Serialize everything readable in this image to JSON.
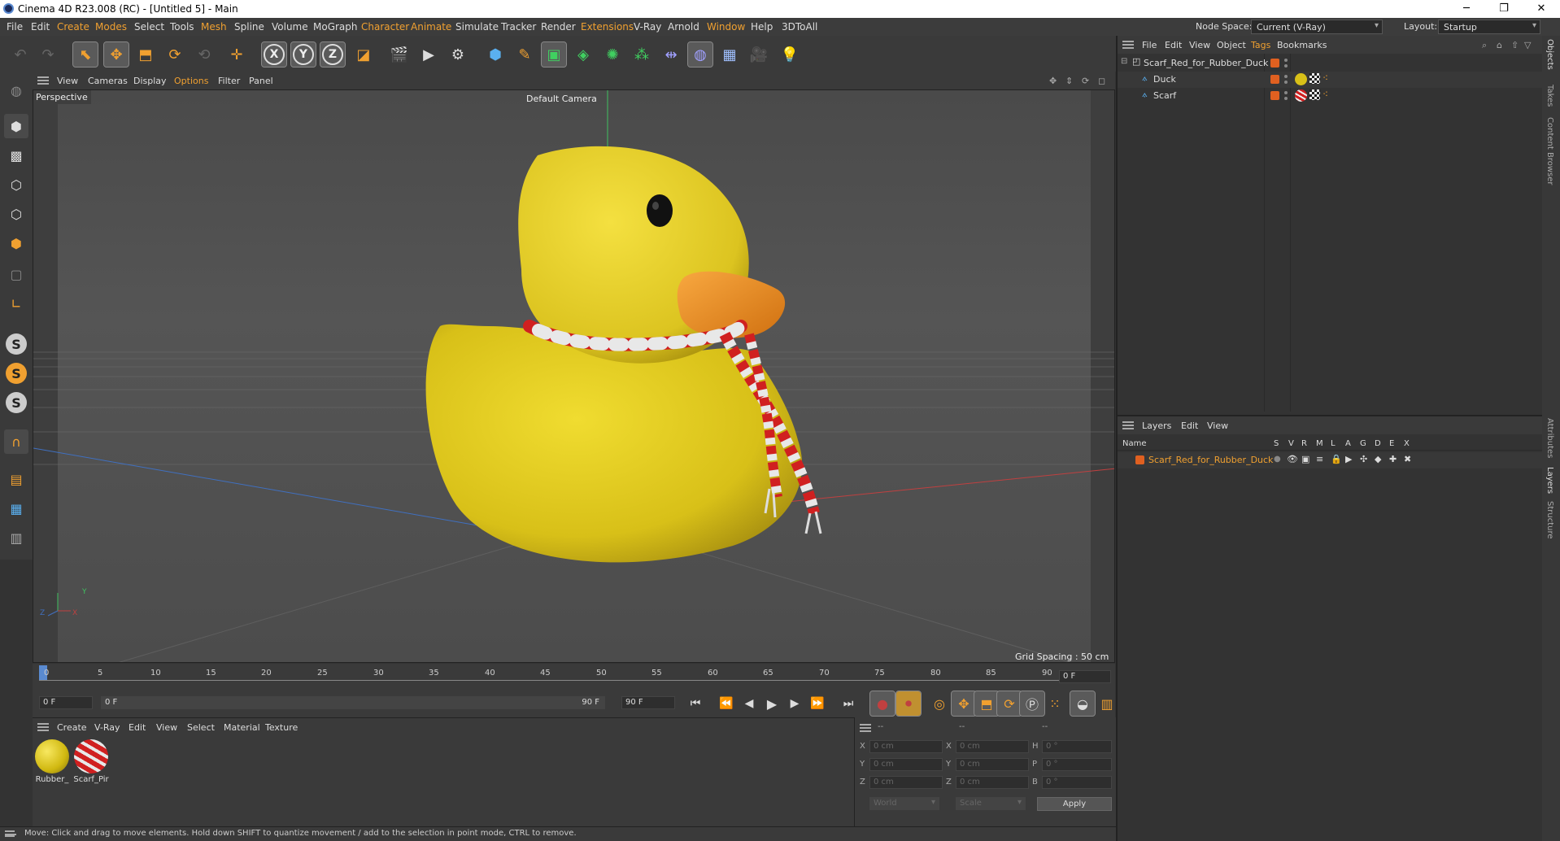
{
  "window": {
    "title": "Cinema 4D R23.008 (RC) - [Untitled 5] - Main",
    "minimize": "─",
    "restore": "❐",
    "close": "✕"
  },
  "menubar": {
    "items": [
      "File",
      "Edit",
      "Create",
      "Modes",
      "Select",
      "Tools",
      "Mesh",
      "Spline",
      "Volume",
      "MoGraph",
      "Character",
      "Animate",
      "Simulate",
      "Tracker",
      "Render",
      "Extensions",
      "V-Ray",
      "Arnold",
      "Window",
      "Help",
      "3DToAll"
    ],
    "node_space_label": "Node Space:",
    "node_space_value": "Current (V-Ray)",
    "layout_label": "Layout:",
    "layout_value": "Startup"
  },
  "viewport_menu": {
    "items": [
      "View",
      "Cameras",
      "Display",
      "Options",
      "Filter",
      "Panel"
    ]
  },
  "viewport": {
    "label": "Perspective",
    "camera": "Default Camera",
    "grid_spacing": "Grid Spacing : 50 cm",
    "axis_y": "Y",
    "axis_z": "Z",
    "axis_x": "X",
    "colors": {
      "bg": "#525252",
      "duck": "#e0c820",
      "beak": "#f09028",
      "scarf_red": "#d02020",
      "scarf_white": "#e8e8e8"
    }
  },
  "timeline": {
    "ticks": [
      "0",
      "5",
      "10",
      "15",
      "20",
      "25",
      "30",
      "35",
      "40",
      "45",
      "50",
      "55",
      "60",
      "65",
      "70",
      "75",
      "80",
      "85",
      "90"
    ],
    "frame_field": "0 F",
    "start_field": "0 F",
    "range_start": "0 F",
    "range_end": "90 F",
    "end_field": "90 F"
  },
  "material_panel": {
    "menu": [
      "Create",
      "V-Ray",
      "Edit",
      "View",
      "Select",
      "Material",
      "Texture"
    ],
    "materials": [
      {
        "name": "Rubber_",
        "color": "#e0c820"
      },
      {
        "name": "Scarf_Pir",
        "color": "#d02020"
      }
    ]
  },
  "coords": {
    "header": [
      "--",
      "--",
      "--"
    ],
    "rows": [
      {
        "a": "X",
        "av": "0 cm",
        "b": "X",
        "bv": "0 cm",
        "c": "H",
        "cv": "0 °"
      },
      {
        "a": "Y",
        "av": "0 cm",
        "b": "Y",
        "bv": "0 cm",
        "c": "P",
        "cv": "0 °"
      },
      {
        "a": "Z",
        "av": "0 cm",
        "b": "Z",
        "bv": "0 cm",
        "c": "B",
        "cv": "0 °"
      }
    ],
    "world": "World",
    "scale": "Scale",
    "apply": "Apply"
  },
  "object_manager": {
    "menu": [
      "File",
      "Edit",
      "View",
      "Object",
      "Tags",
      "Bookmarks"
    ],
    "objects": [
      {
        "name": "Scarf_Red_for_Rubber_Duck",
        "level": 0
      },
      {
        "name": "Duck",
        "level": 1
      },
      {
        "name": "Scarf",
        "level": 1
      }
    ]
  },
  "layer_manager": {
    "menu": [
      "Layers",
      "Edit",
      "View"
    ],
    "name_header": "Name",
    "flags": [
      "S",
      "V",
      "R",
      "M",
      "L",
      "A",
      "G",
      "D",
      "E",
      "X"
    ],
    "layers": [
      {
        "name": "Scarf_Red_for_Rubber_Duck",
        "color": "#e06020"
      }
    ]
  },
  "side_tabs": [
    "Objects",
    "Takes",
    "Content Browser",
    "Attributes",
    "Layers",
    "Structure"
  ],
  "status": "Move: Click and drag to move elements. Hold down SHIFT to quantize movement / add to the selection in point mode, CTRL to remove."
}
